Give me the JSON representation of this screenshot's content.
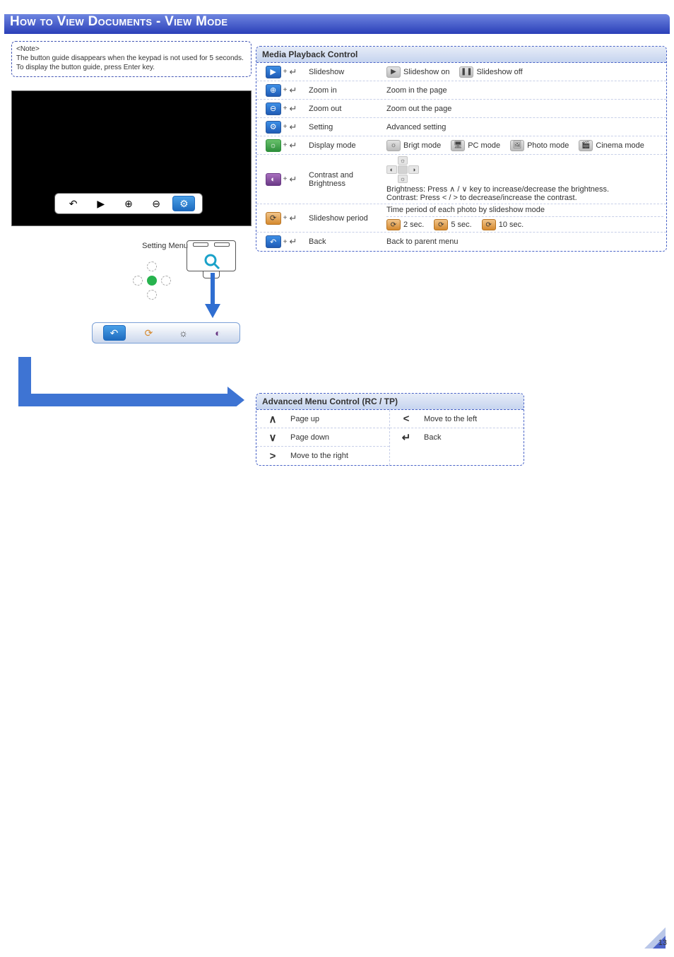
{
  "page": {
    "title": "How to View Documents - View Mode",
    "number": "13"
  },
  "note": {
    "tag": "<Note>",
    "line1": "The button guide disappears when the keypad is not used for 5 seconds.",
    "line2": "To display the button guide, press Enter key."
  },
  "left": {
    "setting_menu_label": "Setting Menu"
  },
  "media_playback": {
    "title": "Media Playback Control",
    "rows": [
      {
        "label": "Slideshow",
        "options": [
          {
            "icon": "▶",
            "cls": "grey",
            "text": "Slideshow on"
          },
          {
            "icon": "❚❚",
            "cls": "grey",
            "text": "Slideshow off"
          }
        ]
      },
      {
        "label": "Zoom in",
        "desc": "Zoom in the page"
      },
      {
        "label": "Zoom out",
        "desc": "Zoom out the page"
      },
      {
        "label": "Setting",
        "desc": "Advanced setting"
      },
      {
        "label": "Display mode",
        "options": [
          {
            "icon": "☼",
            "cls": "grey",
            "text": "Brigt mode"
          },
          {
            "icon": "🖥",
            "cls": "grey",
            "text": "PC mode"
          },
          {
            "icon": "🖼",
            "cls": "grey",
            "text": "Photo mode"
          },
          {
            "icon": "🎬",
            "cls": "grey",
            "text": "Cinema mode"
          }
        ]
      },
      {
        "label": "Contrast and Brightness",
        "sub_before": "dpad",
        "desc": "Brightness: Press ∧ / ∨ key to increase/decrease the brightness.\nContrast: Press  < / >  to decrease/increase the contrast."
      },
      {
        "label": "Slideshow period",
        "desc_above": "Time period of each photo by slideshow mode",
        "options": [
          {
            "icon": "⟳",
            "cls": "orange",
            "text": "2 sec."
          },
          {
            "icon": "⟳",
            "cls": "orange",
            "text": "5 sec."
          },
          {
            "icon": "⟳",
            "cls": "orange",
            "text": "10 sec."
          }
        ]
      },
      {
        "label": "Back",
        "desc": "Back to parent menu"
      }
    ],
    "row_icons": [
      {
        "cls": "",
        "glyph": "▶"
      },
      {
        "cls": "",
        "glyph": "⊕"
      },
      {
        "cls": "",
        "glyph": "⊖"
      },
      {
        "cls": "",
        "glyph": "⚙"
      },
      {
        "cls": "green",
        "glyph": "☼"
      },
      {
        "cls": "purple",
        "glyph": "◐"
      },
      {
        "cls": "orange",
        "glyph": "⟳"
      },
      {
        "cls": "",
        "glyph": "↶"
      }
    ]
  },
  "advanced_menu": {
    "title": "Advanced Menu Control (RC / TP)",
    "left": [
      {
        "sym": "∧",
        "label": "Page up"
      },
      {
        "sym": "∨",
        "label": "Page down"
      },
      {
        "sym": ">",
        "label": "Move to the right"
      }
    ],
    "right": [
      {
        "sym": "<",
        "label": "Move to the left"
      },
      {
        "sym": "↵",
        "label": "Back"
      }
    ]
  }
}
